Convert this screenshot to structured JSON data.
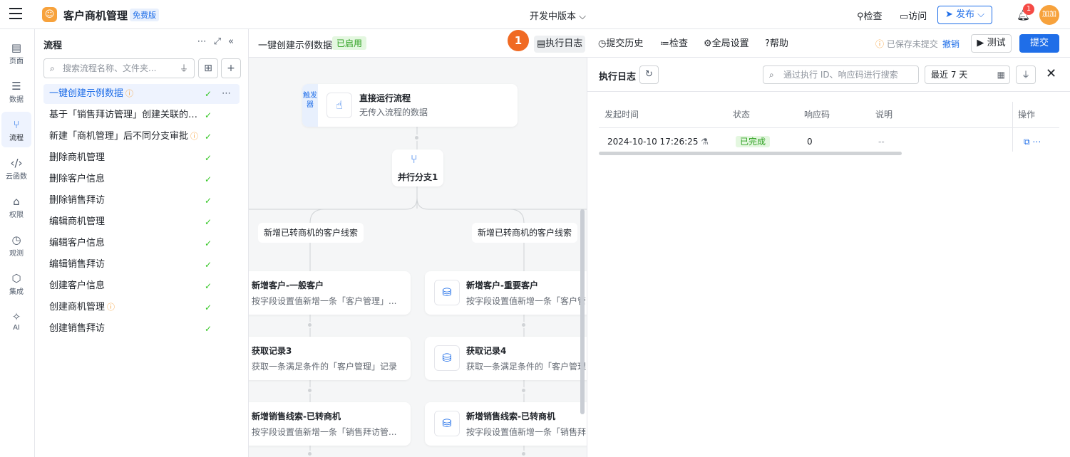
{
  "topbar": {
    "app_title": "客户商机管理",
    "free_badge": "免费版",
    "version": "开发中版本",
    "check": "检查",
    "visit": "访问",
    "publish": "发布",
    "bell_count": "1",
    "avatar": "加加"
  },
  "leftnav": {
    "items": [
      {
        "label": "页面"
      },
      {
        "label": "数据"
      },
      {
        "label": "流程"
      },
      {
        "label": "云函数"
      },
      {
        "label": "权限"
      },
      {
        "label": "观测"
      },
      {
        "label": "集成"
      },
      {
        "label": "AI"
      }
    ]
  },
  "flowpanel": {
    "title": "流程",
    "search_placeholder": "搜索流程名称、文件夹...",
    "items": [
      {
        "name": "一键创建示例数据"
      },
      {
        "name": "基于「销售拜访管理」创建关联的「..."
      },
      {
        "name": "新建「商机管理」后不同分支审批"
      },
      {
        "name": "删除商机管理"
      },
      {
        "name": "删除客户信息"
      },
      {
        "name": "删除销售拜访"
      },
      {
        "name": "编辑商机管理"
      },
      {
        "name": "编辑客户信息"
      },
      {
        "name": "编辑销售拜访"
      },
      {
        "name": "创建客户信息"
      },
      {
        "name": "创建商机管理"
      },
      {
        "name": "创建销售拜访"
      }
    ]
  },
  "editbar": {
    "flow_name": "一键创建示例数据",
    "status": "已启用",
    "step_badge": "1",
    "exec_log": "执行日志",
    "history": "提交历史",
    "check": "检查",
    "global_settings": "全局设置",
    "help": "帮助",
    "saved_text": "已保存未提交",
    "undo": "撤销",
    "test": "测试",
    "submit": "提交"
  },
  "canvas": {
    "trigger_tag": "触发器",
    "trigger_title": "直接运行流程",
    "trigger_sub": "无传入流程的数据",
    "parallel_title": "并行分支1",
    "branch_left_label": "新增已转商机的客户线索",
    "branch_right_label": "新增已转商机的客户线索",
    "left_nodes": [
      {
        "title": "新增客户-一般客户",
        "sub": "按字段设置值新增一条「客户管理」..."
      },
      {
        "title": "获取记录3",
        "sub": "获取一条满足条件的「客户管理」记录"
      },
      {
        "title": "新增销售线索-已转商机",
        "sub": "按字段设置值新增一条「销售拜访管..."
      }
    ],
    "right_nodes": [
      {
        "title": "新增客户-重要客户",
        "sub": "按字段设置值新增一条「客户管"
      },
      {
        "title": "获取记录4",
        "sub": "获取一条满足条件的「客户管理"
      },
      {
        "title": "新增销售线索-已转商机",
        "sub": "按字段设置值新增一条「销售拜"
      }
    ]
  },
  "logpanel": {
    "title": "执行日志",
    "search_placeholder": "通过执行 ID、响应码进行搜索",
    "range": "最近 7 天",
    "columns": [
      "发起时间",
      "状态",
      "响应码",
      "说明",
      "操作"
    ],
    "rows": [
      {
        "time": "2024-10-10 17:26:25",
        "status": "已完成",
        "code": "0",
        "desc": "--"
      }
    ]
  },
  "colors": {
    "primary": "#1f6ee8",
    "success": "#2ea121",
    "warning": "#f7a23c",
    "step_badge": "#f06a23",
    "canvas_bg": "#f5f6f7"
  },
  "icons": {
    "trigger": "hand-pointer-icon",
    "parallel": "fork-icon",
    "db_add": "database-add-icon",
    "db_search": "database-search-icon"
  }
}
